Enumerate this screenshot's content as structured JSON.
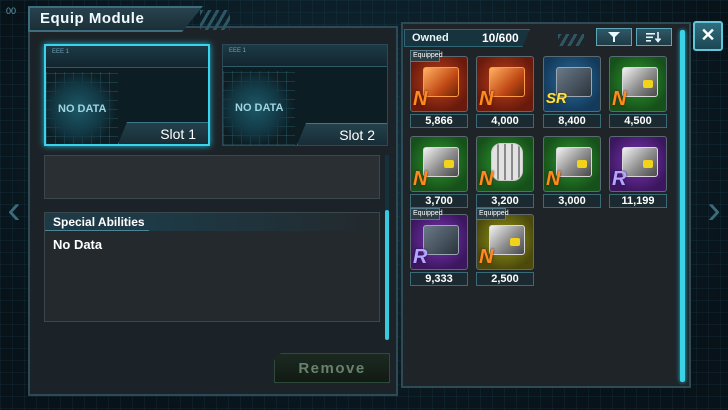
{
  "window": {
    "title": "Equip Module",
    "sys_icon": "00"
  },
  "slots": [
    {
      "label": "Slot 1",
      "status": "NO DATA",
      "tiny": "EEE 1",
      "selected": true
    },
    {
      "label": "Slot 2",
      "status": "NO DATA",
      "tiny": "EEE 1",
      "selected": false
    }
  ],
  "special_abilities": {
    "heading": "Special Abilities",
    "body": "No Data"
  },
  "remove_button": {
    "label": "Remove"
  },
  "inventory": {
    "owned_label": "Owned",
    "owned_count": "10/600",
    "filter_icon": "filter-icon",
    "sort_icon": "sort-icon",
    "close_label": "✕",
    "equipped_label": "Equipped",
    "items": [
      {
        "value": "5,866",
        "rank": "N",
        "color": "red",
        "part": "orange",
        "equipped": true
      },
      {
        "value": "4,000",
        "rank": "N",
        "color": "red",
        "part": "orange",
        "equipped": false
      },
      {
        "value": "8,400",
        "rank": "SR",
        "color": "blue",
        "part": "dark",
        "equipped": false
      },
      {
        "value": "4,500",
        "rank": "N",
        "color": "green",
        "part": "metal",
        "equipped": false
      },
      {
        "value": "3,700",
        "rank": "N",
        "color": "green",
        "part": "metal",
        "equipped": false
      },
      {
        "value": "3,200",
        "rank": "N",
        "color": "green",
        "part": "cyl",
        "equipped": false
      },
      {
        "value": "3,000",
        "rank": "N",
        "color": "green",
        "part": "metal",
        "equipped": false
      },
      {
        "value": "11,199",
        "rank": "R",
        "color": "purple",
        "part": "metal",
        "equipped": false
      },
      {
        "value": "9,333",
        "rank": "R",
        "color": "purple",
        "part": "dark",
        "equipped": true
      },
      {
        "value": "2,500",
        "rank": "N",
        "color": "yellow",
        "part": "metal",
        "equipped": true
      }
    ]
  },
  "colors": {
    "accent": "#39d3ec",
    "panel": "#1c2328",
    "remove_text": "#67826c"
  }
}
